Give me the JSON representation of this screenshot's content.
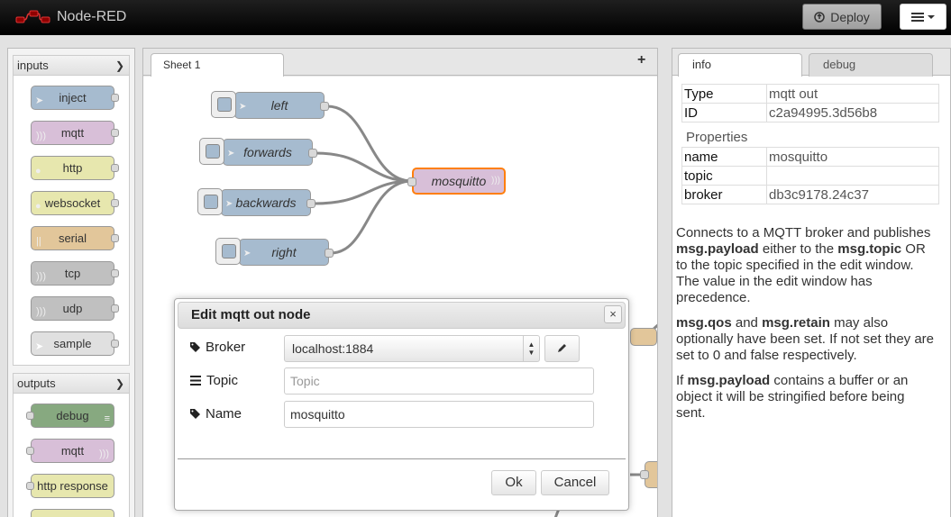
{
  "app": {
    "title": "Node-RED"
  },
  "header": {
    "deploy_label": "Deploy"
  },
  "palette": {
    "categories": [
      {
        "label": "inputs",
        "nodes": [
          {
            "label": "inject",
            "color": "#a6bbcf"
          },
          {
            "label": "mqtt",
            "color": "#d8bfd8"
          },
          {
            "label": "http",
            "color": "#e7e7ae"
          },
          {
            "label": "websocket",
            "color": "#e7e7ae"
          },
          {
            "label": "serial",
            "color": "#e2c69a"
          },
          {
            "label": "tcp",
            "color": "#c0c0c0"
          },
          {
            "label": "udp",
            "color": "#c0c0c0"
          },
          {
            "label": "sample",
            "color": "#e0e0e0"
          }
        ]
      },
      {
        "label": "outputs",
        "nodes": [
          {
            "label": "debug",
            "color": "#87a980"
          },
          {
            "label": "mqtt",
            "color": "#d8bfd8"
          },
          {
            "label": "http response",
            "color": "#e7e7ae"
          }
        ]
      }
    ]
  },
  "workspace": {
    "tabs": [
      {
        "label": "Sheet 1"
      }
    ],
    "add_tab_label": "+",
    "nodes": [
      {
        "label": "left"
      },
      {
        "label": "forwards"
      },
      {
        "label": "backwards"
      },
      {
        "label": "right"
      },
      {
        "label": "mosquitto"
      }
    ]
  },
  "sidebar": {
    "tabs": [
      {
        "label": "info"
      },
      {
        "label": "debug"
      }
    ],
    "type_label": "Type",
    "type_value": "mqtt out",
    "id_label": "ID",
    "id_value": "c2a94995.3d56b8",
    "properties_label": "Properties",
    "properties": [
      {
        "key": "name",
        "value": "mosquitto"
      },
      {
        "key": "topic",
        "value": ""
      },
      {
        "key": "broker",
        "value": "db3c9178.24c37"
      }
    ],
    "info": {
      "p1_a": "Connects to a MQTT broker and publishes ",
      "p1_b": "msg.payload",
      "p1_c": " either to the ",
      "p1_d": "msg.topic",
      "p1_e": " OR to the topic specified in the edit window. The value in the edit window has precedence.",
      "p2_a": "msg.qos",
      "p2_b": " and ",
      "p2_c": "msg.retain",
      "p2_d": " may also optionally have been set. If not set they are set to 0 and false respectively.",
      "p3_a": "If ",
      "p3_b": "msg.payload",
      "p3_c": " contains a buffer or an object it will be stringified before being sent."
    }
  },
  "dialog": {
    "title": "Edit mqtt out node",
    "close_label": "×",
    "broker_label": "Broker",
    "broker_value": "localhost:1884",
    "topic_label": "Topic",
    "topic_placeholder": "Topic",
    "topic_value": "",
    "name_label": "Name",
    "name_value": "mosquitto",
    "ok_label": "Ok",
    "cancel_label": "Cancel"
  }
}
